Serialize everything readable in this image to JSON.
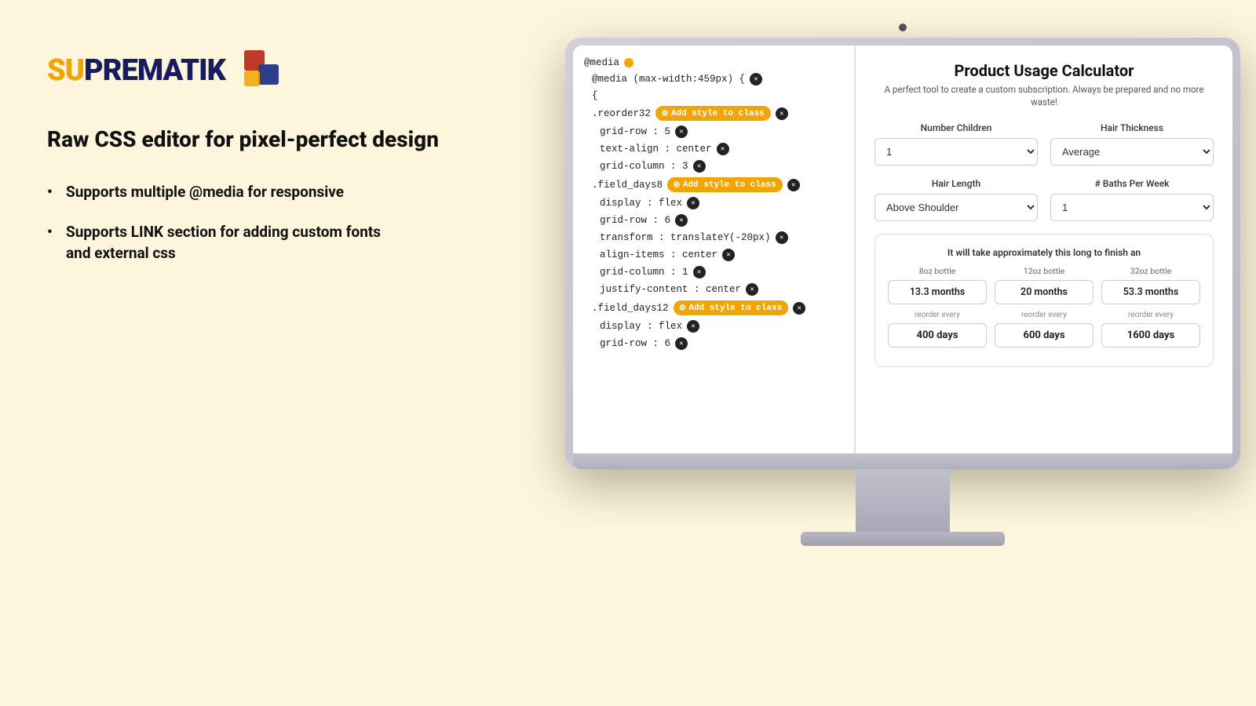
{
  "logo": {
    "text_part1": "SU",
    "text_part2": "PREMATIK"
  },
  "headline": "Raw CSS editor for pixel-perfect design",
  "bullets": [
    {
      "text": "Supports multiple @media for responsive"
    },
    {
      "line1": "Supports LINK section for adding custom fonts",
      "line2": "and external css"
    }
  ],
  "css_editor": {
    "lines": [
      {
        "text": "@media",
        "has_dot": true
      },
      {
        "text": "@media (max-width:459px) {",
        "has_remove": true,
        "indent": 1
      },
      {
        "text": "{",
        "indent": 1
      },
      {
        "text": ".reorder32",
        "has_add": true,
        "has_remove": true,
        "indent": 1
      },
      {
        "text": "grid-row : 5",
        "has_remove": true,
        "indent": 2
      },
      {
        "text": "text-align : center",
        "has_remove": true,
        "indent": 2
      },
      {
        "text": "grid-column : 3",
        "has_remove": true,
        "indent": 2
      },
      {
        "text": ".field_days8",
        "has_add": true,
        "has_remove": true,
        "indent": 1
      },
      {
        "text": "display : flex",
        "has_remove": true,
        "indent": 2
      },
      {
        "text": "grid-row : 6",
        "has_remove": true,
        "indent": 2
      },
      {
        "text": "transform : translateY(-20px)",
        "has_remove": true,
        "indent": 2
      },
      {
        "text": "align-items : center",
        "has_remove": true,
        "indent": 2
      },
      {
        "text": "grid-column : 1",
        "has_remove": true,
        "indent": 2
      },
      {
        "text": "justify-content : center",
        "has_remove": true,
        "indent": 2
      },
      {
        "text": ".field_days12",
        "has_add": true,
        "has_remove": true,
        "indent": 1
      },
      {
        "text": "display : flex",
        "has_remove": true,
        "indent": 2
      },
      {
        "text": "grid-row : 6",
        "has_remove": true,
        "indent": 2
      }
    ],
    "add_style_label": "Add style to class"
  },
  "calculator": {
    "title": "Product Usage Calculator",
    "subtitle": "A perfect tool to create a custom subscription. Always be prepared and no more waste!",
    "fields": {
      "number_children": {
        "label": "Number Children",
        "value": "1"
      },
      "hair_thickness": {
        "label": "Hair Thickness",
        "value": "Average"
      },
      "hair_length": {
        "label": "Hair Length",
        "value": "Above Shoulder"
      },
      "baths_per_week": {
        "label": "# Baths Per Week",
        "value": "1"
      }
    },
    "result": {
      "intro": "It will take approximately this long to finish an",
      "bottles": [
        {
          "label": "8oz bottle",
          "months": "13.3 months",
          "reorder_label": "reorder every",
          "reorder_days": "400 days"
        },
        {
          "label": "12oz bottle",
          "months": "20 months",
          "reorder_label": "reorder every",
          "reorder_days": "600 days"
        },
        {
          "label": "32oz bottle",
          "months": "53.3 months",
          "reorder_label": "reorder every",
          "reorder_days": "1600 days"
        }
      ]
    }
  }
}
